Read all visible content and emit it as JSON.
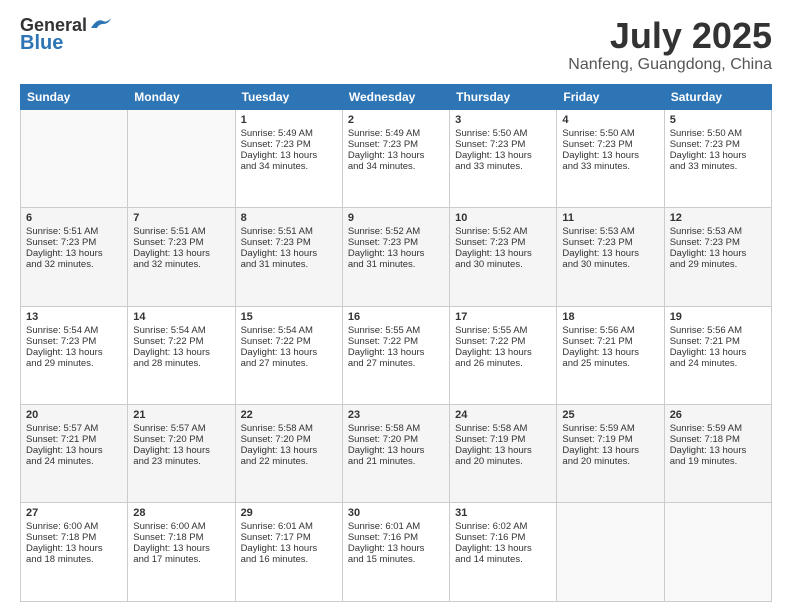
{
  "header": {
    "logo_line1": "General",
    "logo_line2": "Blue",
    "month": "July 2025",
    "location": "Nanfeng, Guangdong, China"
  },
  "weekdays": [
    "Sunday",
    "Monday",
    "Tuesday",
    "Wednesday",
    "Thursday",
    "Friday",
    "Saturday"
  ],
  "weeks": [
    [
      {
        "day": "",
        "info": ""
      },
      {
        "day": "",
        "info": ""
      },
      {
        "day": "1",
        "info": "Sunrise: 5:49 AM\nSunset: 7:23 PM\nDaylight: 13 hours\nand 34 minutes."
      },
      {
        "day": "2",
        "info": "Sunrise: 5:49 AM\nSunset: 7:23 PM\nDaylight: 13 hours\nand 34 minutes."
      },
      {
        "day": "3",
        "info": "Sunrise: 5:50 AM\nSunset: 7:23 PM\nDaylight: 13 hours\nand 33 minutes."
      },
      {
        "day": "4",
        "info": "Sunrise: 5:50 AM\nSunset: 7:23 PM\nDaylight: 13 hours\nand 33 minutes."
      },
      {
        "day": "5",
        "info": "Sunrise: 5:50 AM\nSunset: 7:23 PM\nDaylight: 13 hours\nand 33 minutes."
      }
    ],
    [
      {
        "day": "6",
        "info": "Sunrise: 5:51 AM\nSunset: 7:23 PM\nDaylight: 13 hours\nand 32 minutes."
      },
      {
        "day": "7",
        "info": "Sunrise: 5:51 AM\nSunset: 7:23 PM\nDaylight: 13 hours\nand 32 minutes."
      },
      {
        "day": "8",
        "info": "Sunrise: 5:51 AM\nSunset: 7:23 PM\nDaylight: 13 hours\nand 31 minutes."
      },
      {
        "day": "9",
        "info": "Sunrise: 5:52 AM\nSunset: 7:23 PM\nDaylight: 13 hours\nand 31 minutes."
      },
      {
        "day": "10",
        "info": "Sunrise: 5:52 AM\nSunset: 7:23 PM\nDaylight: 13 hours\nand 30 minutes."
      },
      {
        "day": "11",
        "info": "Sunrise: 5:53 AM\nSunset: 7:23 PM\nDaylight: 13 hours\nand 30 minutes."
      },
      {
        "day": "12",
        "info": "Sunrise: 5:53 AM\nSunset: 7:23 PM\nDaylight: 13 hours\nand 29 minutes."
      }
    ],
    [
      {
        "day": "13",
        "info": "Sunrise: 5:54 AM\nSunset: 7:23 PM\nDaylight: 13 hours\nand 29 minutes."
      },
      {
        "day": "14",
        "info": "Sunrise: 5:54 AM\nSunset: 7:22 PM\nDaylight: 13 hours\nand 28 minutes."
      },
      {
        "day": "15",
        "info": "Sunrise: 5:54 AM\nSunset: 7:22 PM\nDaylight: 13 hours\nand 27 minutes."
      },
      {
        "day": "16",
        "info": "Sunrise: 5:55 AM\nSunset: 7:22 PM\nDaylight: 13 hours\nand 27 minutes."
      },
      {
        "day": "17",
        "info": "Sunrise: 5:55 AM\nSunset: 7:22 PM\nDaylight: 13 hours\nand 26 minutes."
      },
      {
        "day": "18",
        "info": "Sunrise: 5:56 AM\nSunset: 7:21 PM\nDaylight: 13 hours\nand 25 minutes."
      },
      {
        "day": "19",
        "info": "Sunrise: 5:56 AM\nSunset: 7:21 PM\nDaylight: 13 hours\nand 24 minutes."
      }
    ],
    [
      {
        "day": "20",
        "info": "Sunrise: 5:57 AM\nSunset: 7:21 PM\nDaylight: 13 hours\nand 24 minutes."
      },
      {
        "day": "21",
        "info": "Sunrise: 5:57 AM\nSunset: 7:20 PM\nDaylight: 13 hours\nand 23 minutes."
      },
      {
        "day": "22",
        "info": "Sunrise: 5:58 AM\nSunset: 7:20 PM\nDaylight: 13 hours\nand 22 minutes."
      },
      {
        "day": "23",
        "info": "Sunrise: 5:58 AM\nSunset: 7:20 PM\nDaylight: 13 hours\nand 21 minutes."
      },
      {
        "day": "24",
        "info": "Sunrise: 5:58 AM\nSunset: 7:19 PM\nDaylight: 13 hours\nand 20 minutes."
      },
      {
        "day": "25",
        "info": "Sunrise: 5:59 AM\nSunset: 7:19 PM\nDaylight: 13 hours\nand 20 minutes."
      },
      {
        "day": "26",
        "info": "Sunrise: 5:59 AM\nSunset: 7:18 PM\nDaylight: 13 hours\nand 19 minutes."
      }
    ],
    [
      {
        "day": "27",
        "info": "Sunrise: 6:00 AM\nSunset: 7:18 PM\nDaylight: 13 hours\nand 18 minutes."
      },
      {
        "day": "28",
        "info": "Sunrise: 6:00 AM\nSunset: 7:18 PM\nDaylight: 13 hours\nand 17 minutes."
      },
      {
        "day": "29",
        "info": "Sunrise: 6:01 AM\nSunset: 7:17 PM\nDaylight: 13 hours\nand 16 minutes."
      },
      {
        "day": "30",
        "info": "Sunrise: 6:01 AM\nSunset: 7:16 PM\nDaylight: 13 hours\nand 15 minutes."
      },
      {
        "day": "31",
        "info": "Sunrise: 6:02 AM\nSunset: 7:16 PM\nDaylight: 13 hours\nand 14 minutes."
      },
      {
        "day": "",
        "info": ""
      },
      {
        "day": "",
        "info": ""
      }
    ]
  ]
}
